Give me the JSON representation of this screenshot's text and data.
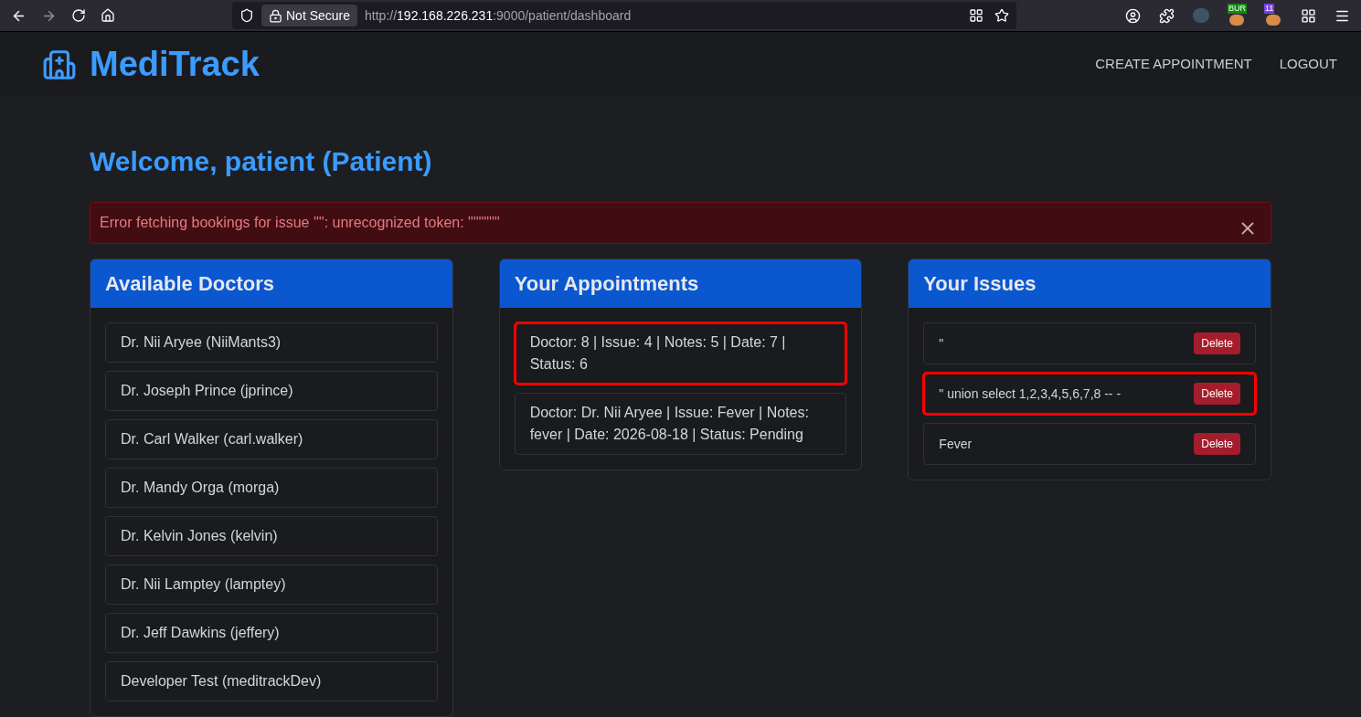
{
  "browser": {
    "security_label": "Not Secure",
    "url": {
      "scheme": "http://",
      "host": "192.168.226.231",
      "rest": ":9000/patient/dashboard"
    },
    "extension_badges": [
      {
        "text": "BUR",
        "color": "#108a10"
      },
      {
        "text": "11",
        "color": "#7542e5"
      }
    ]
  },
  "navbar": {
    "brand": "MediTrack",
    "links": [
      "CREATE APPOINTMENT",
      "LOGOUT"
    ]
  },
  "welcome": "Welcome, patient (Patient)",
  "alert": {
    "message": "Error fetching bookings for issue '\"': unrecognized token: \"'\"\"\"'\"",
    "dismissible": true
  },
  "doctors": {
    "title": "Available Doctors",
    "items": [
      {
        "name": "Dr. Nii Aryee (NiiMants3)"
      },
      {
        "name": "Dr. Joseph Prince (jprince)"
      },
      {
        "name": "Dr. Carl Walker (carl.walker)"
      },
      {
        "name": "Dr. Mandy Orga (morga)"
      },
      {
        "name": "Dr. Kelvin Jones (kelvin)"
      },
      {
        "name": "Dr. Nii Lamptey (lamptey)"
      },
      {
        "name": "Dr. Jeff Dawkins (jeffery)"
      },
      {
        "name": "Developer Test (meditrackDev)"
      }
    ]
  },
  "appointments": {
    "title": "Your Appointments",
    "items": [
      {
        "text": "Doctor: 8 | Issue: 4 | Notes: 5 | Date: 7 | Status: 6",
        "highlighted": true
      },
      {
        "text": "Doctor: Dr. Nii Aryee | Issue: Fever | Notes: fever | Date: 2026-08-18 | Status: Pending",
        "highlighted": false
      }
    ]
  },
  "issues": {
    "title": "Your Issues",
    "items": [
      {
        "text": "\"",
        "action": "Delete",
        "highlighted": false
      },
      {
        "text": "\" union select 1,2,3,4,5,6,7,8 -- -",
        "action": "Delete",
        "highlighted": true
      },
      {
        "text": "Fever",
        "action": "Delete",
        "highlighted": false
      }
    ]
  }
}
